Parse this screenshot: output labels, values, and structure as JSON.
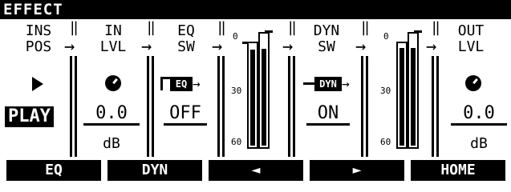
{
  "title": "EFFECT",
  "columns": {
    "ins_pos": {
      "label1": "INS",
      "label2": "POS",
      "value": "PLAY",
      "icon": "play-icon"
    },
    "in_lvl": {
      "label1": "IN",
      "label2": "LVL",
      "value": "0.0",
      "unit": "dB",
      "icon": "knob-icon"
    },
    "eq_sw": {
      "label1": "EQ",
      "label2": "SW",
      "value": "OFF",
      "block": "EQ"
    },
    "meter1": {
      "scale_top": "0",
      "scale_mid": "30",
      "scale_bot": "60",
      "levels": [
        0.92,
        0.85
      ]
    },
    "dyn_sw": {
      "label1": "DYN",
      "label2": "SW",
      "value": "ON",
      "block": "DYN"
    },
    "meter2": {
      "scale_top": "0",
      "scale_mid": "30",
      "scale_bot": "60",
      "levels": [
        0.94,
        0.86
      ]
    },
    "out_lvl": {
      "label1": "OUT",
      "label2": "LVL",
      "value": "0.0",
      "unit": "dB",
      "icon": "knob-icon"
    }
  },
  "softkeys": [
    "EQ",
    "DYN",
    "◄",
    "►",
    "HOME"
  ]
}
